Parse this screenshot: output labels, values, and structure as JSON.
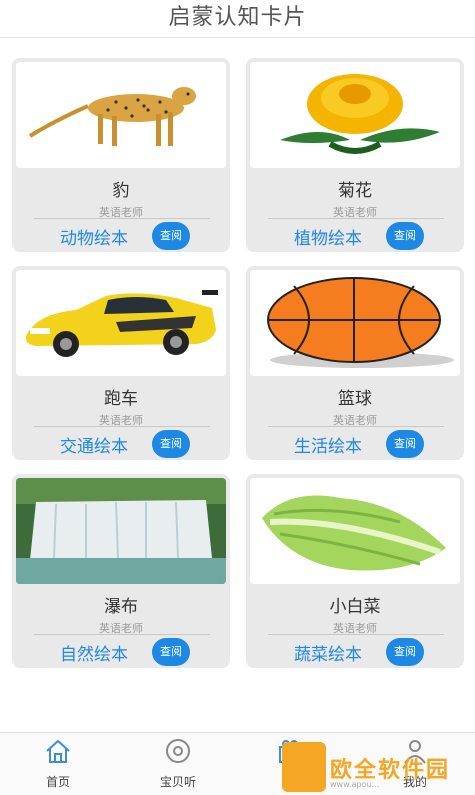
{
  "header": {
    "title": "启蒙认知卡片"
  },
  "cards": [
    {
      "name": "豹",
      "teacher": "英语老师",
      "category": "动物绘本",
      "button": "查阅",
      "image": "cheetah"
    },
    {
      "name": "菊花",
      "teacher": "英语老师",
      "category": "植物绘本",
      "button": "查阅",
      "image": "chrysanthemum"
    },
    {
      "name": "跑车",
      "teacher": "英语老师",
      "category": "交通绘本",
      "button": "查阅",
      "image": "sports-car"
    },
    {
      "name": "篮球",
      "teacher": "英语老师",
      "category": "生活绘本",
      "button": "查阅",
      "image": "basketball"
    },
    {
      "name": "瀑布",
      "teacher": "英语老师",
      "category": "自然绘本",
      "button": "查阅",
      "image": "waterfall"
    },
    {
      "name": "小白菜",
      "teacher": "英语老师",
      "category": "蔬菜绘本",
      "button": "查阅",
      "image": "bok-choy"
    }
  ],
  "tabbar": {
    "items": [
      {
        "label": "首页",
        "icon": "home-icon"
      },
      {
        "label": "宝贝听",
        "icon": "disc-icon"
      },
      {
        "label": "",
        "icon": "gift-icon"
      },
      {
        "label": "我的",
        "icon": "user-icon"
      }
    ]
  },
  "watermark": {
    "text": "欧全软件园",
    "url": "www.apou…"
  }
}
